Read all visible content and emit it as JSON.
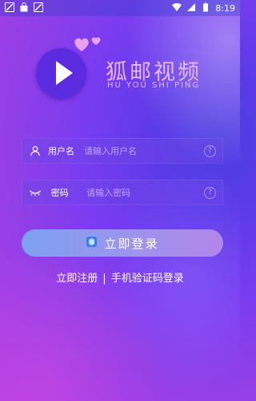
{
  "status_bar": {
    "time": "8:19"
  },
  "brand": {
    "title": "狐邮视频",
    "subtitle": "HU YOU SHI PING"
  },
  "form": {
    "username_label": "用户名",
    "username_placeholder": "请输入用户名",
    "password_label": "密码",
    "password_placeholder": "请输入密码"
  },
  "actions": {
    "login_label": "立即登录",
    "register_label": "立即注册",
    "separator": "|",
    "sms_login_label": "手机验证码登录"
  },
  "colors": {
    "accent_text": "#e9b7f4",
    "button_start": "#7ea1f0",
    "button_end": "#b285e9"
  }
}
